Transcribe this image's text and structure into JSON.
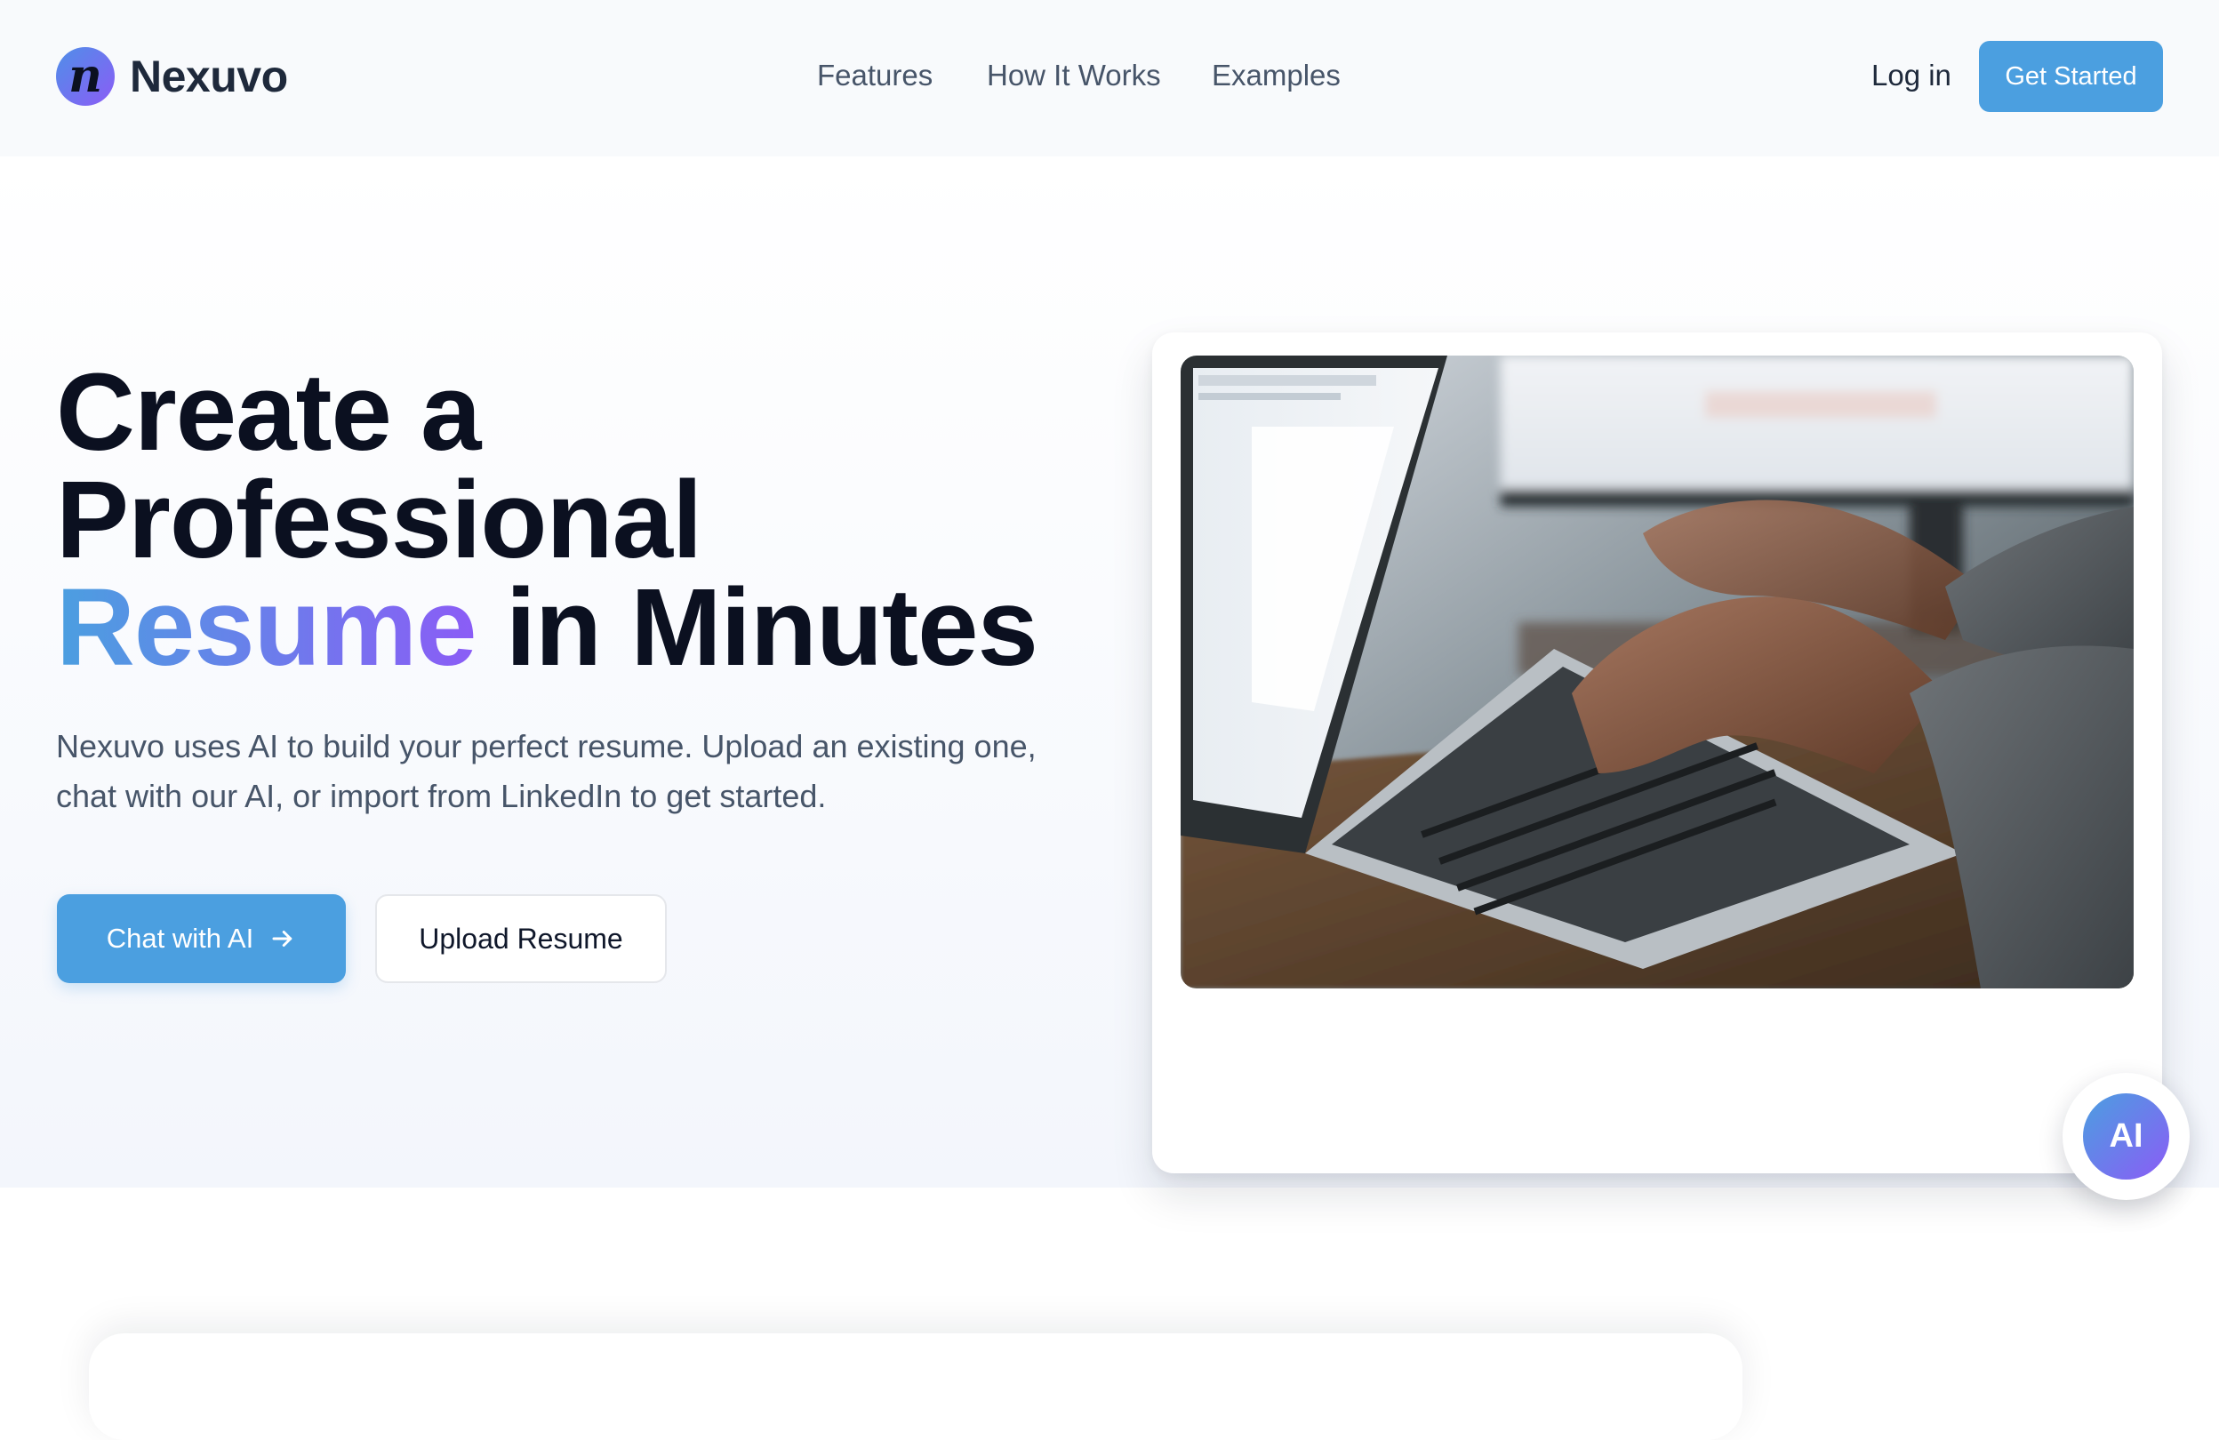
{
  "brand": {
    "logo_glyph": "n",
    "name": "Nexuvo"
  },
  "nav": {
    "links": [
      "Features",
      "How It Works",
      "Examples"
    ],
    "login_label": "Log in",
    "cta_label": "Get Started"
  },
  "hero": {
    "headline_line1": "Create a",
    "headline_line2": "Professional",
    "headline_highlight": "Resume",
    "headline_line3_rest": "in Minutes",
    "subtitle": "Nexuvo uses AI to build your perfect resume. Upload an existing one, chat with our AI, or import from LinkedIn to get started.",
    "primary_button_label": "Chat with AI",
    "primary_button_icon": "arrow-right-icon",
    "secondary_button_label": "Upload Resume",
    "image_alt": "Person typing on a laptop",
    "ai_badge_label": "AI"
  },
  "colors": {
    "accent": "#4b9fe0",
    "gradient_end": "#8b5cf6",
    "heading": "#0b1020",
    "body_text": "#475569",
    "nav_bg": "#f8fafc"
  }
}
